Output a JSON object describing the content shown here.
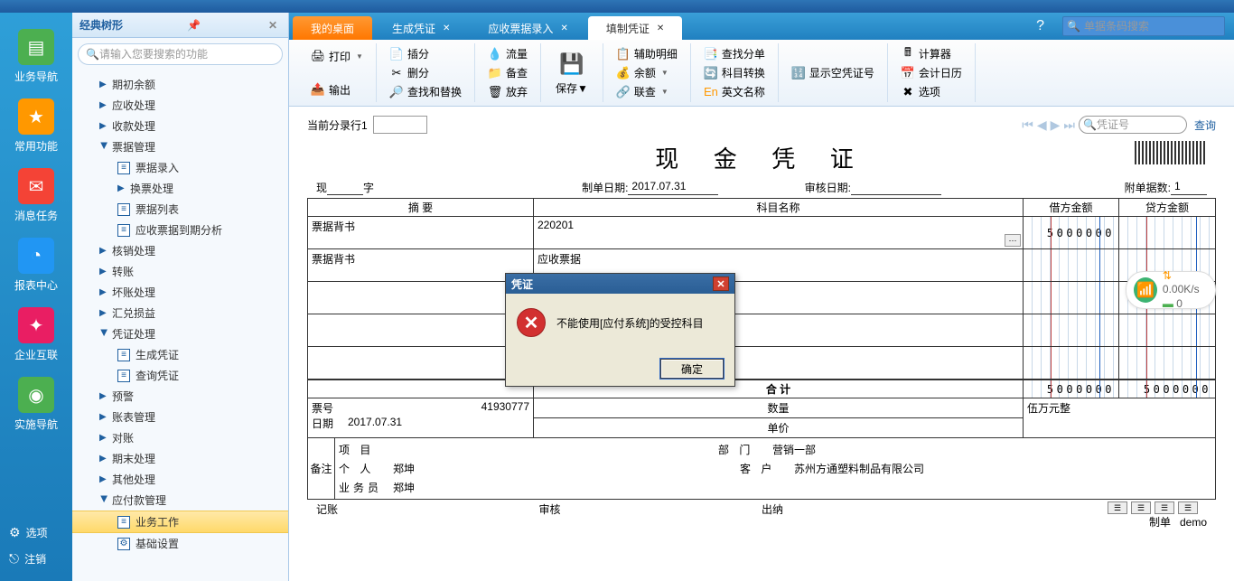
{
  "topSearch": {
    "placeholder": "单据条码搜索"
  },
  "leftNav": {
    "items": [
      {
        "label": "业务导航",
        "color": "#4caf50",
        "glyph": "▤"
      },
      {
        "label": "常用功能",
        "color": "#ff9800",
        "glyph": "★"
      },
      {
        "label": "消息任务",
        "color": "#f44336",
        "glyph": "✉"
      },
      {
        "label": "报表中心",
        "color": "#2196f3",
        "glyph": "◔"
      },
      {
        "label": "企业互联",
        "color": "#e91e63",
        "glyph": "✦"
      },
      {
        "label": "实施导航",
        "color": "#4caf50",
        "glyph": "◉"
      }
    ],
    "bottom": {
      "options": "选项",
      "logout": "注销"
    }
  },
  "tree": {
    "title": "经典树形",
    "searchPlaceholder": "请输入您要搜索的功能",
    "items": [
      {
        "label": "期初余额",
        "level": 1,
        "arrow": true
      },
      {
        "label": "应收处理",
        "level": 1,
        "arrow": true
      },
      {
        "label": "收款处理",
        "level": 1,
        "arrow": true
      },
      {
        "label": "票据管理",
        "level": 1,
        "arrow": true,
        "open": true
      },
      {
        "label": "票据录入",
        "level": 2,
        "doc": true
      },
      {
        "label": "换票处理",
        "level": 2,
        "arrow": true
      },
      {
        "label": "票据列表",
        "level": 2,
        "doc": true
      },
      {
        "label": "应收票据到期分析",
        "level": 2,
        "doc": true
      },
      {
        "label": "核销处理",
        "level": 1,
        "arrow": true
      },
      {
        "label": "转账",
        "level": 1,
        "arrow": true
      },
      {
        "label": "坏账处理",
        "level": 1,
        "arrow": true
      },
      {
        "label": "汇兑损益",
        "level": 1,
        "arrow": true
      },
      {
        "label": "凭证处理",
        "level": 1,
        "arrow": true,
        "open": true
      },
      {
        "label": "生成凭证",
        "level": 2,
        "doc": true
      },
      {
        "label": "查询凭证",
        "level": 2,
        "doc": true
      },
      {
        "label": "预警",
        "level": 1,
        "arrow": true
      },
      {
        "label": "账表管理",
        "level": 1,
        "arrow": true
      },
      {
        "label": "对账",
        "level": 1,
        "arrow": true
      },
      {
        "label": "期末处理",
        "level": 1,
        "arrow": true
      },
      {
        "label": "其他处理",
        "level": 1,
        "arrow": true
      },
      {
        "label": "应付款管理",
        "level": 1,
        "arrow": true,
        "open": true
      },
      {
        "label": "业务工作",
        "level": 2,
        "doc": true,
        "active": true
      },
      {
        "label": "基础设置",
        "level": 2,
        "gear": true
      }
    ]
  },
  "tabs": [
    {
      "label": "我的桌面",
      "type": "orange"
    },
    {
      "label": "生成凭证",
      "closable": true
    },
    {
      "label": "应收票据录入",
      "closable": true
    },
    {
      "label": "填制凭证",
      "closable": true,
      "active": true
    }
  ],
  "toolbar": {
    "print": "打印",
    "output": "输出",
    "insert": "插分",
    "delete": "删分",
    "findReplace": "查找和替换",
    "flow": "流量",
    "backup": "备查",
    "abandon": "放弃",
    "save": "保存",
    "auxDetail": "辅助明细",
    "balance": "余额",
    "linkQuery": "联查",
    "findSplit": "查找分单",
    "subjectConvert": "科目转换",
    "englishName": "英文名称",
    "showEmpty": "显示空凭证号",
    "calculator": "计算器",
    "calendar": "会计日历",
    "options": "选项"
  },
  "voucher": {
    "currentLineLabel": "当前分录行1",
    "voucherNoLabel": "凭证号",
    "queryLabel": "查询",
    "title": "现 金 凭 证",
    "typePrefix": "现",
    "typeSuffix": "字",
    "makeDateLabel": "制单日期:",
    "makeDate": "2017.07.31",
    "auditDateLabel": "审核日期:",
    "auditDate": "",
    "attachLabel": "附单据数:",
    "attachCount": "1",
    "headers": {
      "summary": "摘 要",
      "subject": "科目名称",
      "debit": "借方金额",
      "credit": "贷方金额"
    },
    "rows": [
      {
        "summary": "票据背书",
        "subject": "220201",
        "debit": "5000000",
        "credit": "",
        "browse": true
      },
      {
        "summary": "票据背书",
        "subject": "应收票据",
        "debit": "",
        "credit": ""
      },
      {
        "summary": "",
        "subject": "",
        "debit": "",
        "credit": ""
      },
      {
        "summary": "",
        "subject": "",
        "debit": "",
        "credit": ""
      },
      {
        "summary": "",
        "subject": "",
        "debit": "",
        "credit": ""
      }
    ],
    "total": {
      "label": "合 计",
      "debit": "5000000",
      "credit": "5000000"
    },
    "billNoLabel": "票号",
    "billNo": "41930777",
    "dateLabel": "日期",
    "date": "2017.07.31",
    "qtyLabel": "数量",
    "priceLabel": "单价",
    "amountWords": "伍万元整",
    "remarkLabel": "备注",
    "remark": {
      "projectLabel": "项 目",
      "project": "",
      "deptLabel": "部 门",
      "dept": "营销一部",
      "personLabel": "个 人",
      "person": "郑坤",
      "custLabel": "客 户",
      "cust": "苏州方通塑料制品有限公司",
      "clerkLabel": "业务员",
      "clerk": "郑坤"
    },
    "footer": {
      "book": "记账",
      "audit": "审核",
      "cashier": "出纳",
      "make": "制单",
      "maker": "demo"
    }
  },
  "modal": {
    "title": "凭证",
    "message": "不能使用[应付系统]的受控科目",
    "ok": "确定"
  },
  "wifi": {
    "speed": "0.00K/s",
    "count": "0"
  }
}
